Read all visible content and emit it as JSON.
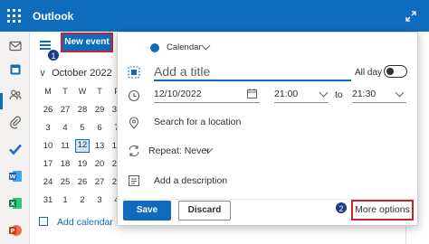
{
  "app": {
    "title": "Outlook"
  },
  "toolbar": {
    "new_event_label": "New event"
  },
  "steps": [
    "1",
    "2"
  ],
  "mini_calendar": {
    "month_label": "October 2022",
    "weekdays": [
      "M",
      "T",
      "W",
      "T",
      "F",
      "S",
      "S"
    ],
    "weeks": [
      [
        "26",
        "27",
        "28",
        "29",
        "30",
        "1",
        "2"
      ],
      [
        "3",
        "4",
        "5",
        "6",
        "7",
        "8",
        "9"
      ],
      [
        "10",
        "11",
        "12",
        "13",
        "14",
        "15",
        "16"
      ],
      [
        "17",
        "18",
        "19",
        "20",
        "21",
        "22",
        "23"
      ],
      [
        "24",
        "25",
        "26",
        "27",
        "28",
        "29",
        "30"
      ],
      [
        "31",
        "1",
        "2",
        "3",
        "4",
        "5",
        "6"
      ]
    ],
    "selected_day": "12"
  },
  "add_calendar_label": "Add calendar",
  "event_form": {
    "calendar_label": "Calendar",
    "calendar_color": "#0f6cbd",
    "title_placeholder": "Add a title",
    "all_day_label": "All day",
    "start_date": "12/10/2022",
    "start_time": "21:00",
    "to_label": "to",
    "end_time": "21:30",
    "location_placeholder": "Search for a location",
    "repeat_label": "Repeat:",
    "repeat_value": "Never",
    "description_placeholder": "Add a description"
  },
  "footer": {
    "save_label": "Save",
    "discard_label": "Discard",
    "more_options_label": "More options"
  },
  "colors": {
    "accent": "#0f6cbd",
    "highlight": "#c4262e"
  }
}
